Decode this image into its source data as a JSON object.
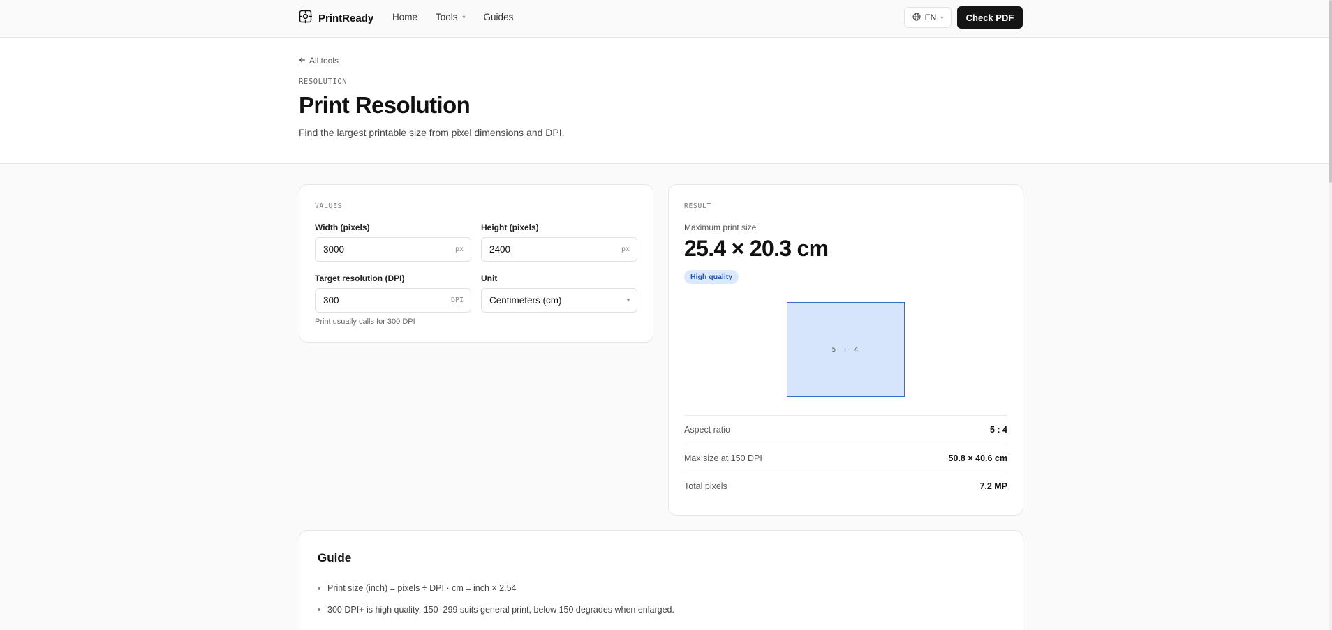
{
  "header": {
    "brand": "PrintReady",
    "nav": [
      {
        "label": "Home"
      },
      {
        "label": "Tools",
        "has_caret": true
      },
      {
        "label": "Guides"
      }
    ],
    "language": "EN",
    "cta_label": "Check PDF"
  },
  "hero": {
    "back_link": "All tools",
    "eyebrow": "RESOLUTION",
    "title": "Print Resolution",
    "subtitle": "Find the largest printable size from pixel dimensions and DPI."
  },
  "values": {
    "section_label": "VALUES",
    "width": {
      "label": "Width (pixels)",
      "value": "3000",
      "suffix": "px"
    },
    "height": {
      "label": "Height (pixels)",
      "value": "2400",
      "suffix": "px"
    },
    "dpi": {
      "label": "Target resolution (DPI)",
      "value": "300",
      "suffix": "DPI"
    },
    "unit": {
      "label": "Unit",
      "value": "Centimeters (cm)"
    },
    "hint": "Print usually calls for 300 DPI"
  },
  "result": {
    "section_label": "RESULT",
    "max_label": "Maximum print size",
    "max_size": "25.4 × 20.3 cm",
    "quality_badge": "High quality",
    "preview_ratio": "5 : 4",
    "rows": [
      {
        "key": "Aspect ratio",
        "value": "5 : 4"
      },
      {
        "key": "Max size at 150 DPI",
        "value": "50.8 × 40.6 cm"
      },
      {
        "key": "Total pixels",
        "value": "7.2 MP"
      }
    ]
  },
  "guide": {
    "title": "Guide",
    "items": [
      "Print size (inch) = pixels ÷ DPI · cm = inch × 2.54",
      "300 DPI+ is high quality, 150–299 suits general print, below 150 degrades when enlarged."
    ]
  },
  "colors": {
    "accent_badge_bg": "#dbe8fd",
    "accent_badge_text": "#2457a6",
    "preview_fill": "#d6e5fc",
    "preview_stroke": "#3a6cc2",
    "cta_bg": "#141414"
  }
}
